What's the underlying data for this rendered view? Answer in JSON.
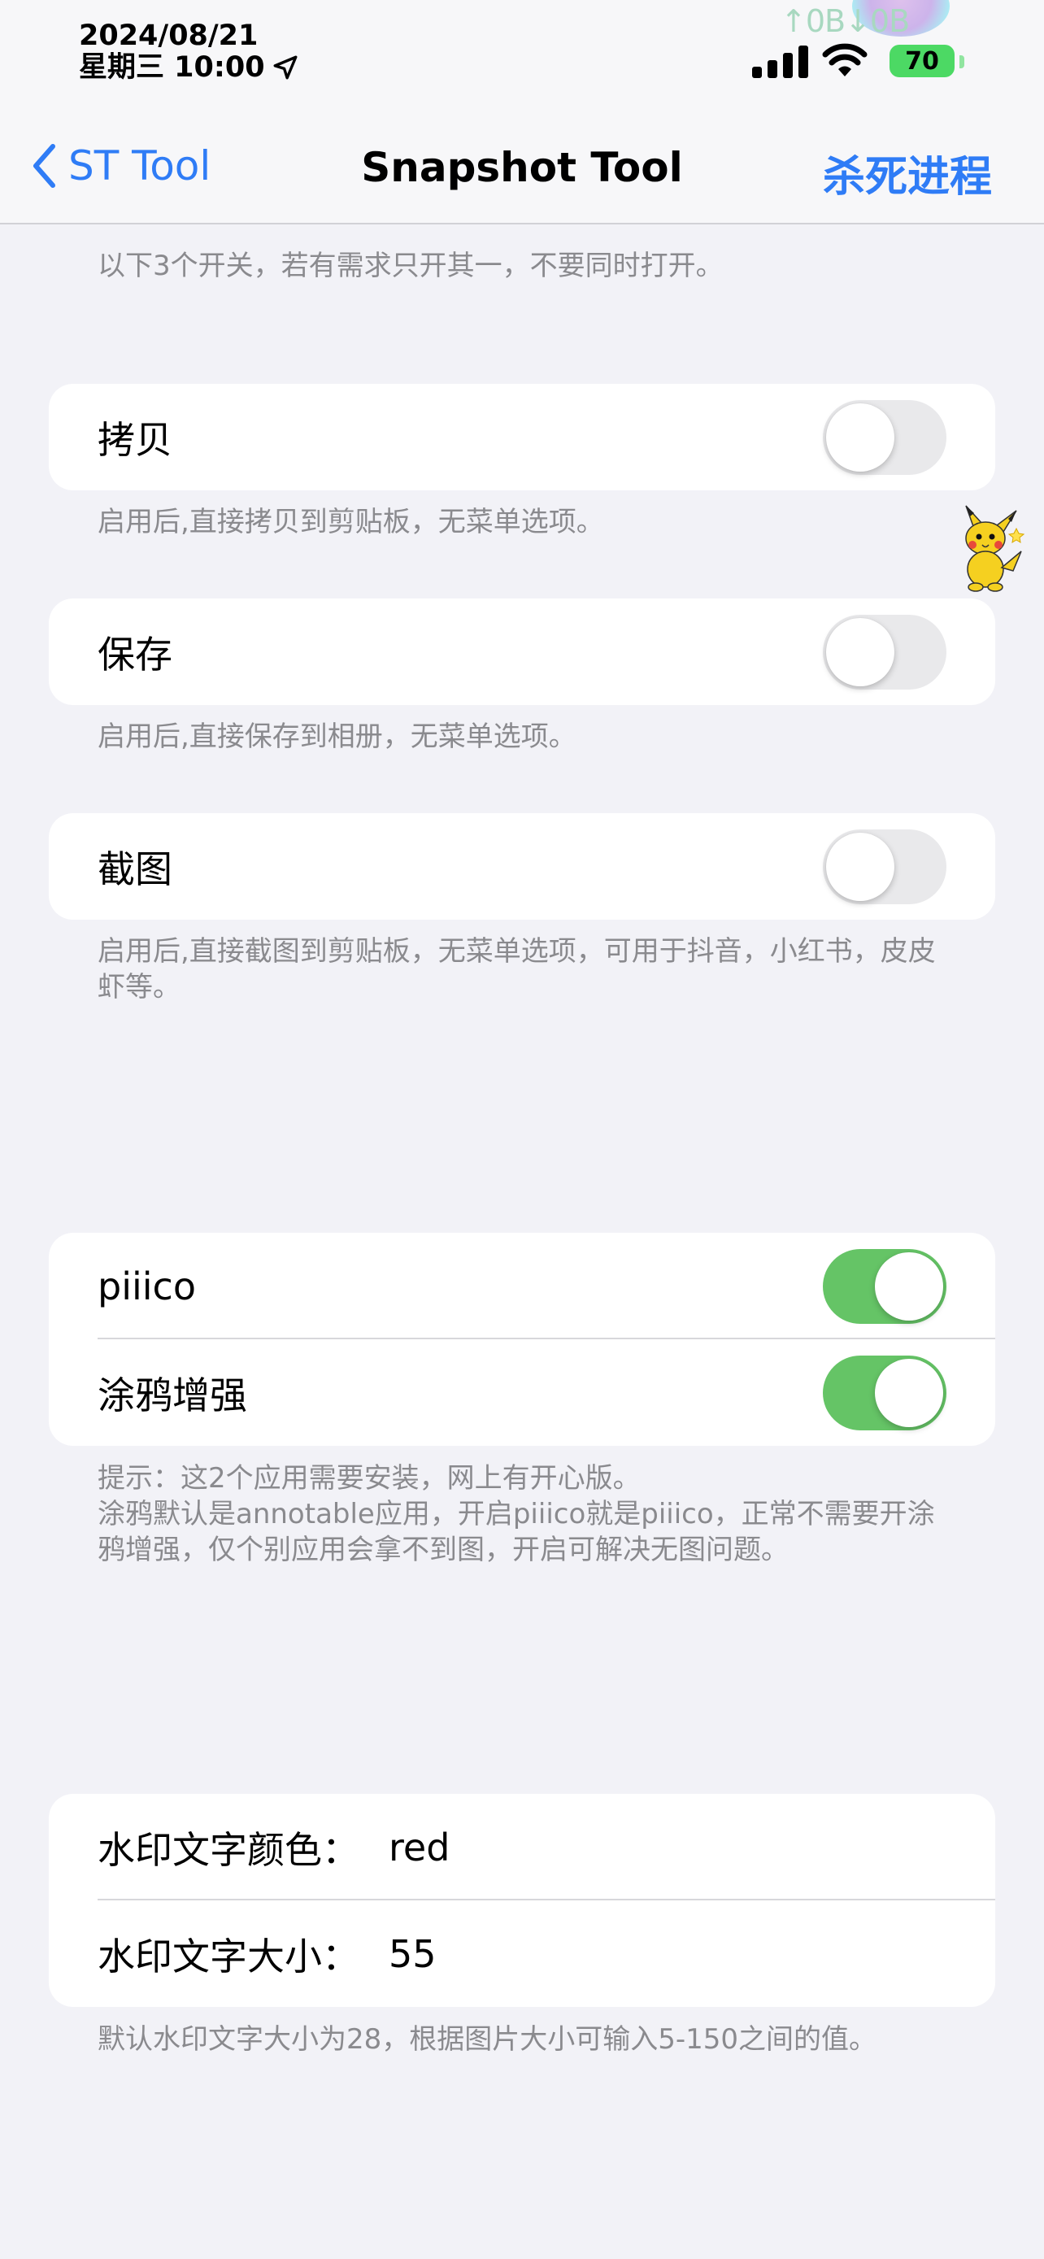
{
  "status_bar": {
    "date": "2024/08/21",
    "weekday_time": "星期三 10:00",
    "net_speed": "↑0B↓0B",
    "battery": "70",
    "icons": [
      "location-arrow-icon",
      "cellular-signal-icon",
      "wifi-icon",
      "battery-icon"
    ]
  },
  "nav": {
    "back_label": "ST Tool",
    "title": "Snapshot Tool",
    "action_label": "杀死进程",
    "accent_color": "#2f7cf6"
  },
  "intro_note": "以下3个开关，若有需求只开其一，不要同时打开。",
  "copy": {
    "label": "拷贝",
    "on": false,
    "note": "启用后,直接拷贝到剪贴板，无菜单选项。"
  },
  "save": {
    "label": "保存",
    "on": false,
    "note": "启用后,直接保存到相册，无菜单选项。"
  },
  "screenshot": {
    "label": "截图",
    "on": false,
    "note": "启用后,直接截图到剪贴板，无菜单选项，可用于抖音，小红书，皮皮虾等。"
  },
  "apps": {
    "piiico": {
      "label": "piiico",
      "on": true
    },
    "doodle": {
      "label": "涂鸦增强",
      "on": true
    },
    "note": "提示：这2个应用需要安装，网上有开心版。\n涂鸦默认是annotable应用，开启piiico就是piiico，正常不需要开涂鸦增强，仅个别应用会拿不到图，开启可解决无图问题。"
  },
  "watermark": {
    "color_label": "水印文字颜色：",
    "color_value": "red",
    "size_label": "水印文字大小：",
    "size_value": "55",
    "note": "默认水印文字大小为28，根据图片大小可输入5-150之间的值。"
  },
  "toggle_on_color": "#65c466"
}
